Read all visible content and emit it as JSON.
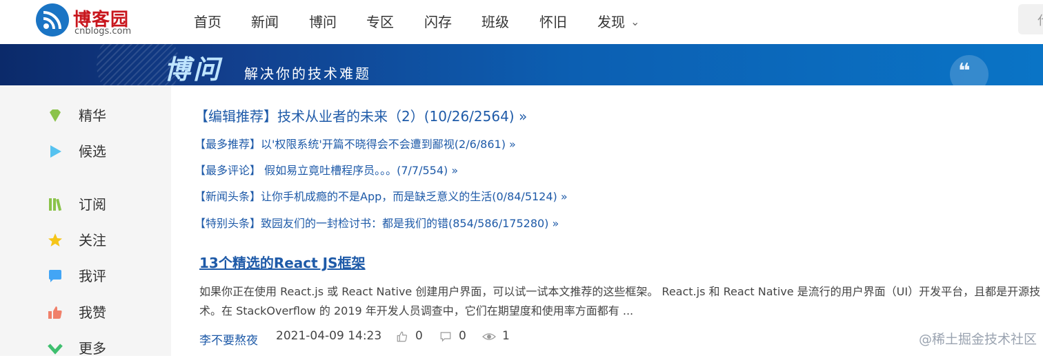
{
  "logo": {
    "name": "博客园",
    "domain": "cnblogs.com"
  },
  "nav": [
    "首页",
    "新闻",
    "博问",
    "专区",
    "闪存",
    "班级",
    "怀旧",
    "发现"
  ],
  "search": {
    "placeholder": "代"
  },
  "banner": {
    "title": "博问",
    "subtitle": "解决你的技术难题"
  },
  "sidebar": {
    "items": [
      {
        "label": "精华",
        "icon": "diamond-icon",
        "color": "#8bc34a"
      },
      {
        "label": "候选",
        "icon": "play-icon",
        "color": "#56c2f0"
      },
      {
        "label": "订阅",
        "icon": "books-icon",
        "color": "#8bc34a"
      },
      {
        "label": "关注",
        "icon": "star-icon",
        "color": "#f5c518"
      },
      {
        "label": "我评",
        "icon": "comment-icon",
        "color": "#42a5f5"
      },
      {
        "label": "我赞",
        "icon": "thumbs-up-icon",
        "color": "#f0806a"
      },
      {
        "label": "更多",
        "icon": "chevron-down-icon",
        "color": "#3fbf6f"
      }
    ]
  },
  "headlines": [
    "【编辑推荐】技术从业者的未来（2）(10/26/2564) »",
    "【最多推荐】以'权限系统'开篇不晓得会不会遭到鄙视(2/6/861) »",
    "【最多评论】 假如易立竟吐槽程序员。。。(7/7/554) »",
    "【新闻头条】让你手机成瘾的不是App，而是缺乏意义的生活(0/84/5124) »",
    "【特别头条】致园友们的一封检讨书：都是我们的错(854/586/175280) »"
  ],
  "article": {
    "title": "13个精选的React JS框架",
    "summary": "如果你正在使用 React.js 或 React Native 创建用户界面，可以试一试本文推荐的这些框架。 React.js 和 React Native 是流行的用户界面（UI）开发平台，且都是开源技术。在 StackOverflow 的 2019 年开发人员调查中，它们在期望度和使用率方面都有 ...",
    "author": "李不要熬夜",
    "date": "2021-04-09 14:23",
    "likes": "0",
    "comments": "0",
    "views": "1"
  },
  "watermark": "@稀土掘金技术社区"
}
